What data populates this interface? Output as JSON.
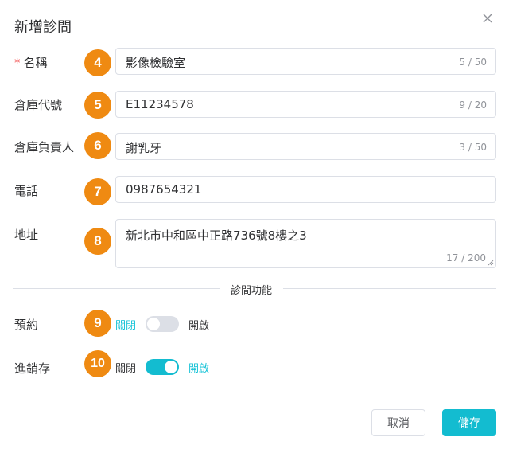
{
  "dialog": {
    "title": "新增診間",
    "close_icon": "close-icon"
  },
  "fields": {
    "name": {
      "required_mark": "*",
      "label": "名稱",
      "badge": "4",
      "value": "影像檢驗室",
      "count": "5 / 50"
    },
    "warehouse_code": {
      "label": "倉庫代號",
      "badge": "5",
      "value": "E11234578",
      "count": "9 / 20"
    },
    "warehouse_owner": {
      "label": "倉庫負責人",
      "badge": "6",
      "value": "謝乳牙",
      "count": "3 / 50"
    },
    "phone": {
      "label": "電話",
      "badge": "7",
      "value": "0987654321"
    },
    "address": {
      "label": "地址",
      "badge": "8",
      "value": "新北市中和區中正路736號8樓之3",
      "count": "17 / 200"
    }
  },
  "section": {
    "title": "診間功能"
  },
  "switches": {
    "appointment": {
      "label": "預約",
      "badge": "9",
      "off_label": "關閉",
      "on_label": "開啟",
      "state": "off"
    },
    "inventory": {
      "label": "進銷存",
      "badge": "10",
      "off_label": "關閉",
      "on_label": "開啟",
      "state": "on"
    }
  },
  "footer": {
    "cancel_label": "取消",
    "save_label": "儲存"
  },
  "colors": {
    "accent": "#13bcd0",
    "badge": "#ef8a12",
    "required": "#f56c6c"
  }
}
